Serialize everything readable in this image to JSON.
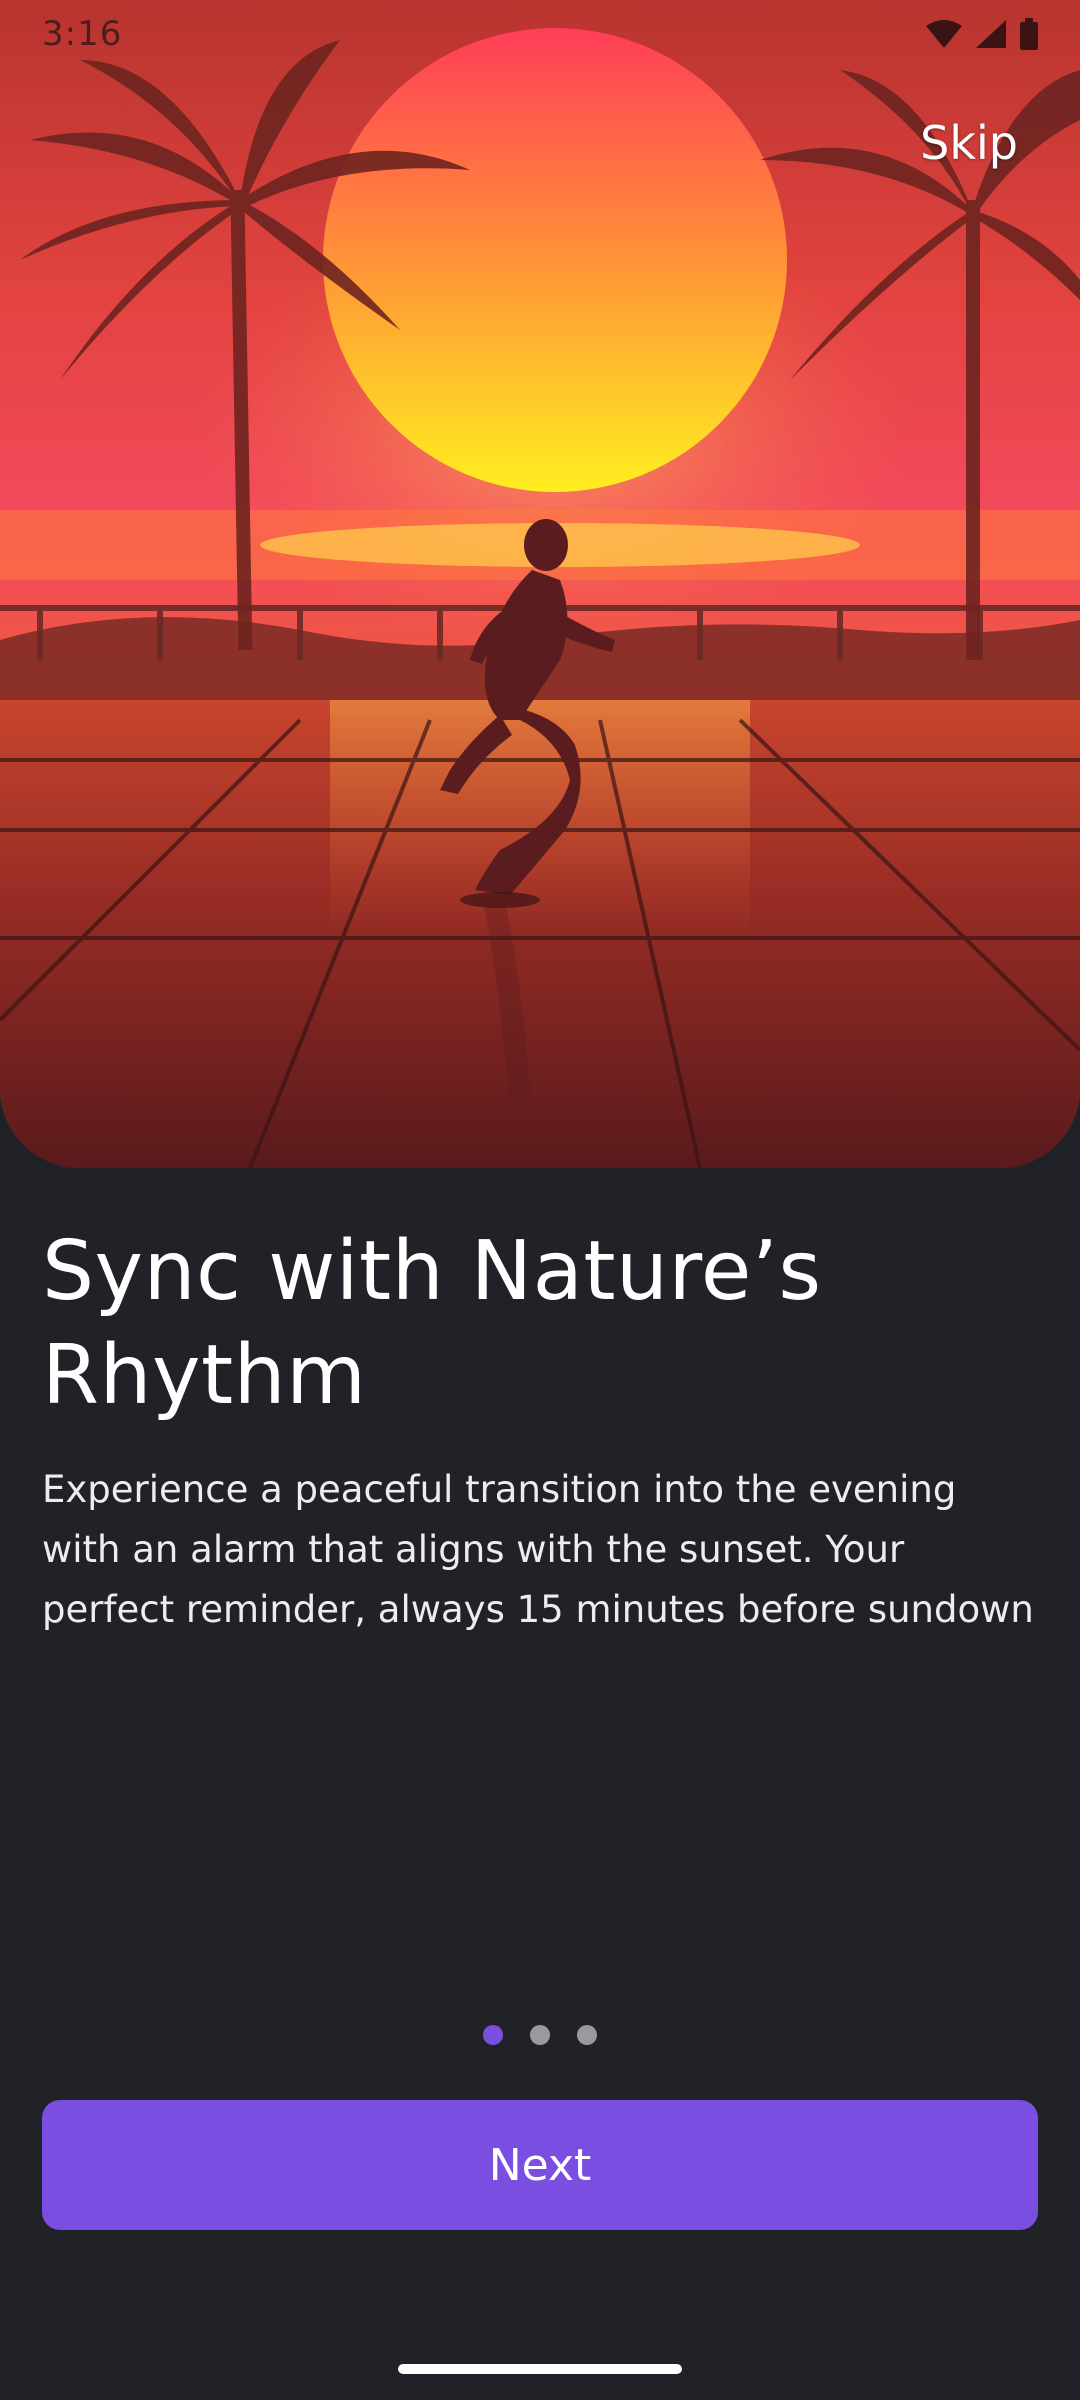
{
  "status_bar": {
    "time": "3:16",
    "icons": [
      "wifi-icon",
      "cellular-signal-icon",
      "battery-icon"
    ]
  },
  "hero": {
    "image": "sunset-runner-illustration",
    "colors": {
      "sky_top": "#c93a3a",
      "sky_mid": "#f24a5a",
      "sun": "#ffd033",
      "floor": "#6a1f1d"
    }
  },
  "onboarding": {
    "skip_label": "Skip",
    "title": "Sync with Nature’s Rhythm",
    "description": "Experience a peaceful transition into the evening with an alarm that aligns with the sunset. Your perfect reminder, always 15 minutes before sundown",
    "page_indicator": {
      "current": 1,
      "total": 3
    },
    "next_label": "Next"
  },
  "colors": {
    "background": "#212227",
    "accent": "#7a4ee0",
    "inactive_dot": "#9a9a9e"
  }
}
